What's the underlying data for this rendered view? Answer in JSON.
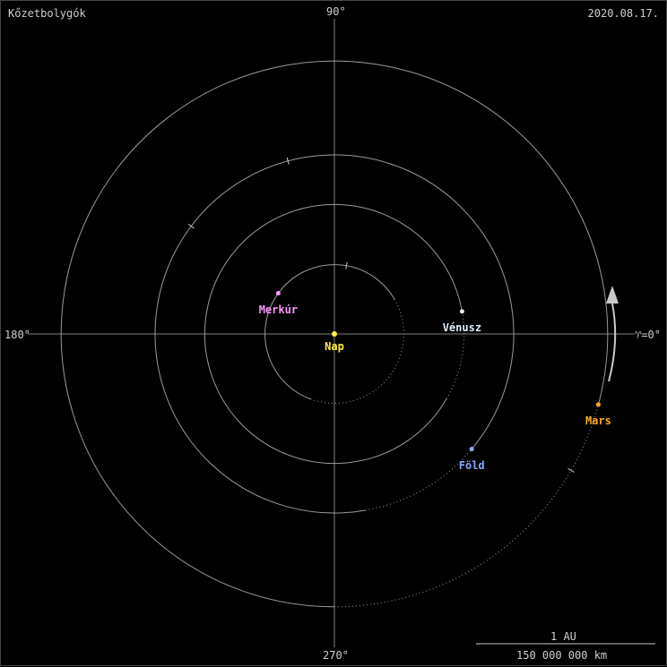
{
  "header": {
    "title": "Kőzetbolygók",
    "date": "2020.08.17."
  },
  "axes": {
    "deg_90": "90°",
    "deg_180": "180°",
    "deg_270": "270°",
    "deg_0": "♈=0°"
  },
  "scale": {
    "label": "1 AU",
    "value": "150 000 000 km"
  },
  "colors": {
    "background": "#000000",
    "axis": "#808080",
    "orbit": "#9a9a9a",
    "arrow": "#c8c8c8"
  },
  "sun": {
    "name": "Nap",
    "color": "#ffee44"
  },
  "planets": [
    {
      "key": "mercury",
      "name": "Merkúr",
      "color": "#ff99ff",
      "a_au": 0.387,
      "angle_deg": 144
    },
    {
      "key": "venus",
      "name": "Vénusz",
      "color": "#ddeeff",
      "a_au": 0.723,
      "angle_deg": 10
    },
    {
      "key": "earth",
      "name": "Föld",
      "color": "#88aaff",
      "a_au": 1.0,
      "angle_deg": -40
    },
    {
      "key": "mars",
      "name": "Mars",
      "color": "#ffaa22",
      "a_au": 1.524,
      "angle_deg": -15
    }
  ]
}
